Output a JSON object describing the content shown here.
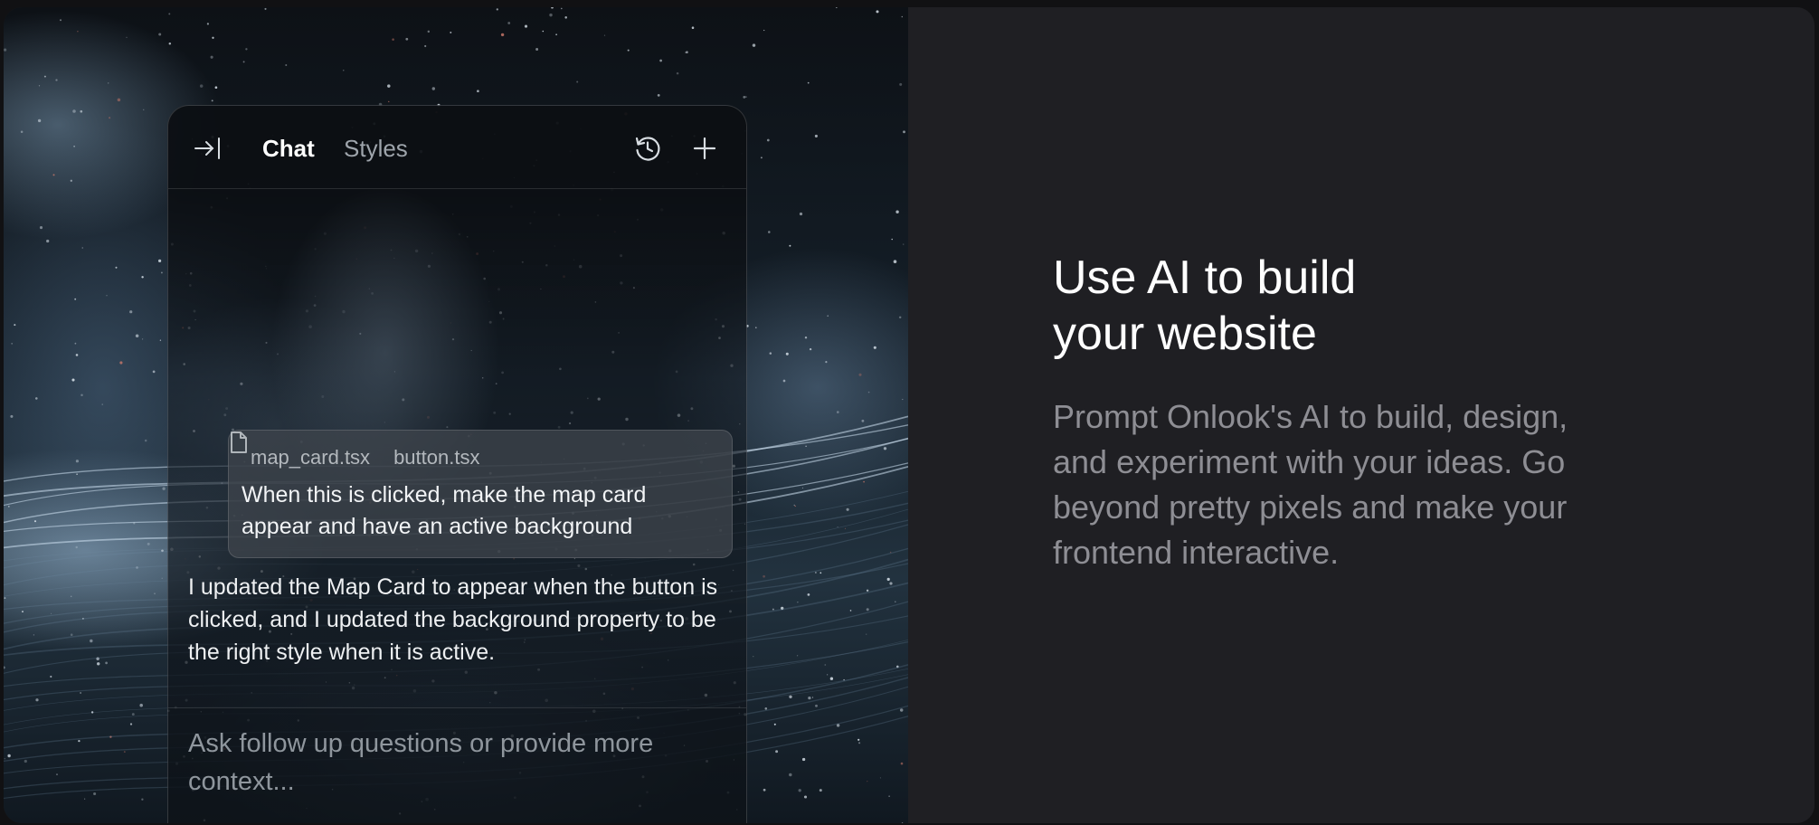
{
  "chat_panel": {
    "tabs": [
      {
        "label": "Chat",
        "active": true
      },
      {
        "label": "Styles",
        "active": false
      }
    ],
    "icons": {
      "collapse": "arrow-right-to-line-icon",
      "history": "history-icon",
      "new_chat": "plus-icon"
    },
    "user_message": {
      "files": [
        "map_card.tsx",
        "button.tsx"
      ],
      "text": "When this is clicked, make the map card appear and have an active background"
    },
    "assistant_message": "I updated the Map Card to appear when the button is clicked, and I updated the background property to be the right style when it is active.",
    "input": {
      "placeholder": "Ask follow up questions or provide more context...",
      "value": ""
    }
  },
  "feature": {
    "headline_line1": "Use AI to build",
    "headline_line2": "your website",
    "description": "Prompt Onlook's AI to build, design, and experiment with your ideas. Go beyond pretty pixels and make your frontend interactive."
  },
  "colors": {
    "page_background": "#111113",
    "right_panel": "#1f1f23",
    "headline": "#ffffff",
    "description": "#8e8e94",
    "active_tab": "#ffffff",
    "inactive_tab": "#9ea4ab"
  }
}
